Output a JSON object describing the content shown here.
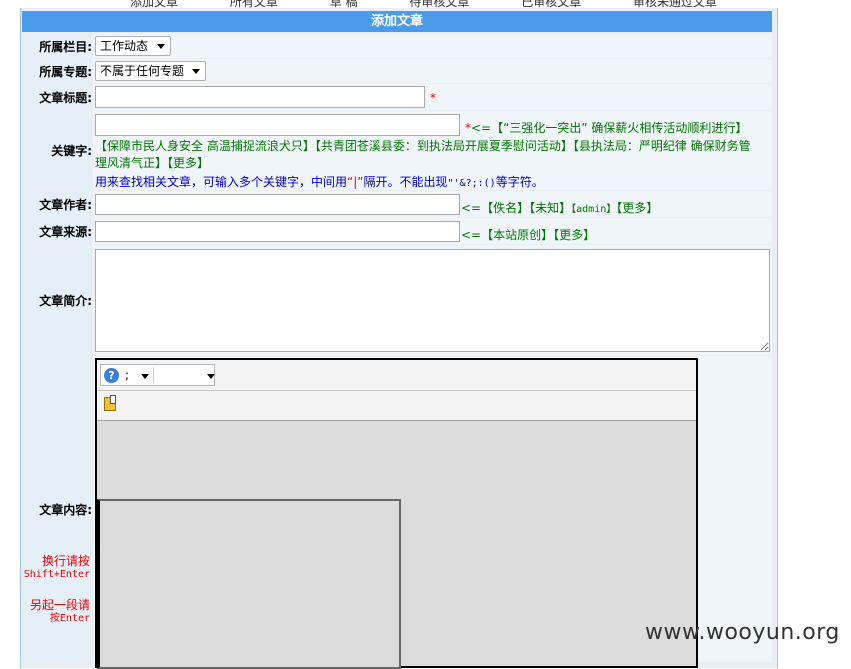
{
  "top_nav": [
    "添加文章",
    "所有文章",
    "草 稿",
    "待审核文章",
    "已审核文章",
    "审核未通过文章"
  ],
  "form_title": "添加文章",
  "fields": {
    "column": {
      "label": "所属栏目:",
      "value": "工作动态"
    },
    "topic": {
      "label": "所属专题:",
      "value": "不属于任何专题"
    },
    "title": {
      "label": "文章标题:",
      "value": "",
      "required_mark": "*"
    },
    "keywords": {
      "label": "关键字:",
      "value": "",
      "required_mark": "*",
      "prefix": "<=",
      "suggestion_1": "【“三强化一突出” 确保薪火相传活动顺利进行】",
      "suggestion_2": "【保障市民人身安全 高温捕捉流浪犬只】",
      "suggestion_3": "【共青团苍溪县委：到执法局开展夏季慰问活动】",
      "suggestion_4": "【县执法局：严明纪律 确保财务管",
      "suggestion_4b": "理风清气正】",
      "more": "【更多】",
      "help_a": "用来查找相关文章，可输入多个关键字，中间用",
      "help_sep": "“|”",
      "help_b": "隔开。不能出现",
      "help_chars": "\"'&?;:()",
      "help_c": "等字符。"
    },
    "author": {
      "label": "文章作者:",
      "value": "",
      "prefix": "<=",
      "opt1": "【佚名】",
      "opt2": "【未知】",
      "opt3": "【admin】",
      "opt4": "【更多】"
    },
    "source": {
      "label": "文章来源:",
      "value": "",
      "prefix": "<=",
      "opt1": "【本站原创】",
      "opt2": "【更多】"
    },
    "intro": {
      "label": "文章简介:",
      "value": ""
    },
    "content": {
      "label": "文章内容:",
      "toolbar_help_icon": "question-icon",
      "toolbar_font_value": ";",
      "toolbar_size_value": "",
      "paste_icon": "paste-icon",
      "note1_line1": "换行请按",
      "note1_line2": "Shift+Enter",
      "note2_line1": "另起一段请",
      "note2_line2": "按Enter"
    }
  },
  "watermark": "www.wooyun.org"
}
